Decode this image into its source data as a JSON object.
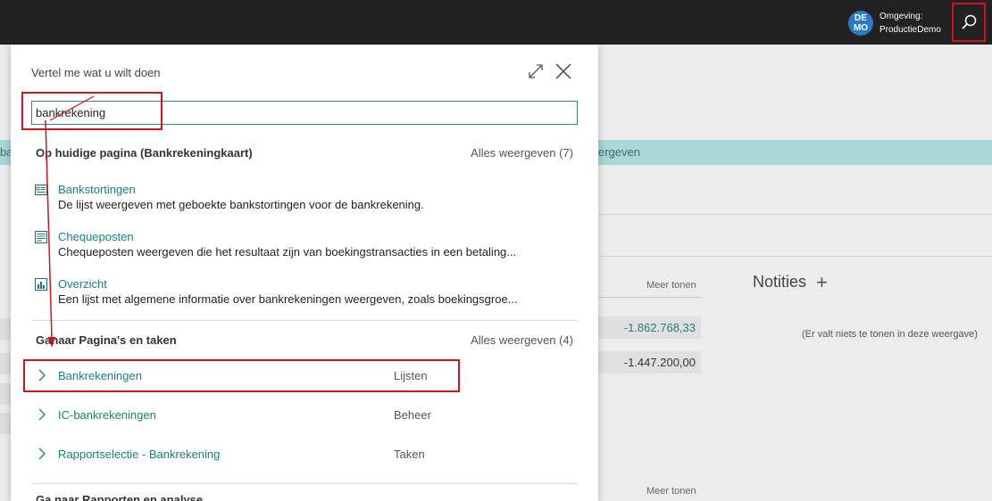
{
  "topbar": {
    "avatar_initials_1": "DE",
    "avatar_initials_2": "MO",
    "env_label": "Omgeving:",
    "env_name": "ProductieDemo",
    "search_icon": "search-icon"
  },
  "background": {
    "strip_left": "ba",
    "strip_right": "ergeven",
    "meer_tonen_1": "Meer tonen",
    "meer_tonen_2": "Meer tonen",
    "value_1": "-1.862.768,33",
    "value_2": "-1.447.200,00",
    "notities": "Notities",
    "notities_add": "+",
    "empty_note": "(Er valt niets te tonen in deze weergave)"
  },
  "dialog": {
    "title": "Vertel me wat u wilt doen",
    "search_value": "bankrekening",
    "section1": {
      "heading": "Op huidige pagina (Bankrekeningkaart)",
      "show_all": "Alles weergeven (7)",
      "items": [
        {
          "title": "Bankstortingen",
          "desc": "De lijst weergeven met geboekte bankstortingen voor de bankrekening.",
          "icon": "list-icon"
        },
        {
          "title": "Chequeposten",
          "desc": "Chequeposten weergeven die het resultaat zijn van boekingstransacties in een betaling...",
          "icon": "entries-icon"
        },
        {
          "title": "Overzicht",
          "desc": "Een lijst met algemene informatie over bankrekeningen weergeven, zoals boekingsgroe...",
          "icon": "chart-icon"
        }
      ]
    },
    "section2": {
      "heading": "Ganaar Pagina's en taken",
      "show_all": "Alles weergeven (4)",
      "items": [
        {
          "label": "Bankrekeningen",
          "category": "Lijsten"
        },
        {
          "label": "IC-bankrekeningen",
          "category": "Beheer"
        },
        {
          "label": "Rapportselectie - Bankrekening",
          "category": "Taken"
        }
      ]
    },
    "section3_cut": "Ga naar Rapporten en analyse"
  },
  "colors": {
    "accent": "#1a7f7f",
    "highlight": "#d0141b",
    "topbar": "#222222"
  }
}
